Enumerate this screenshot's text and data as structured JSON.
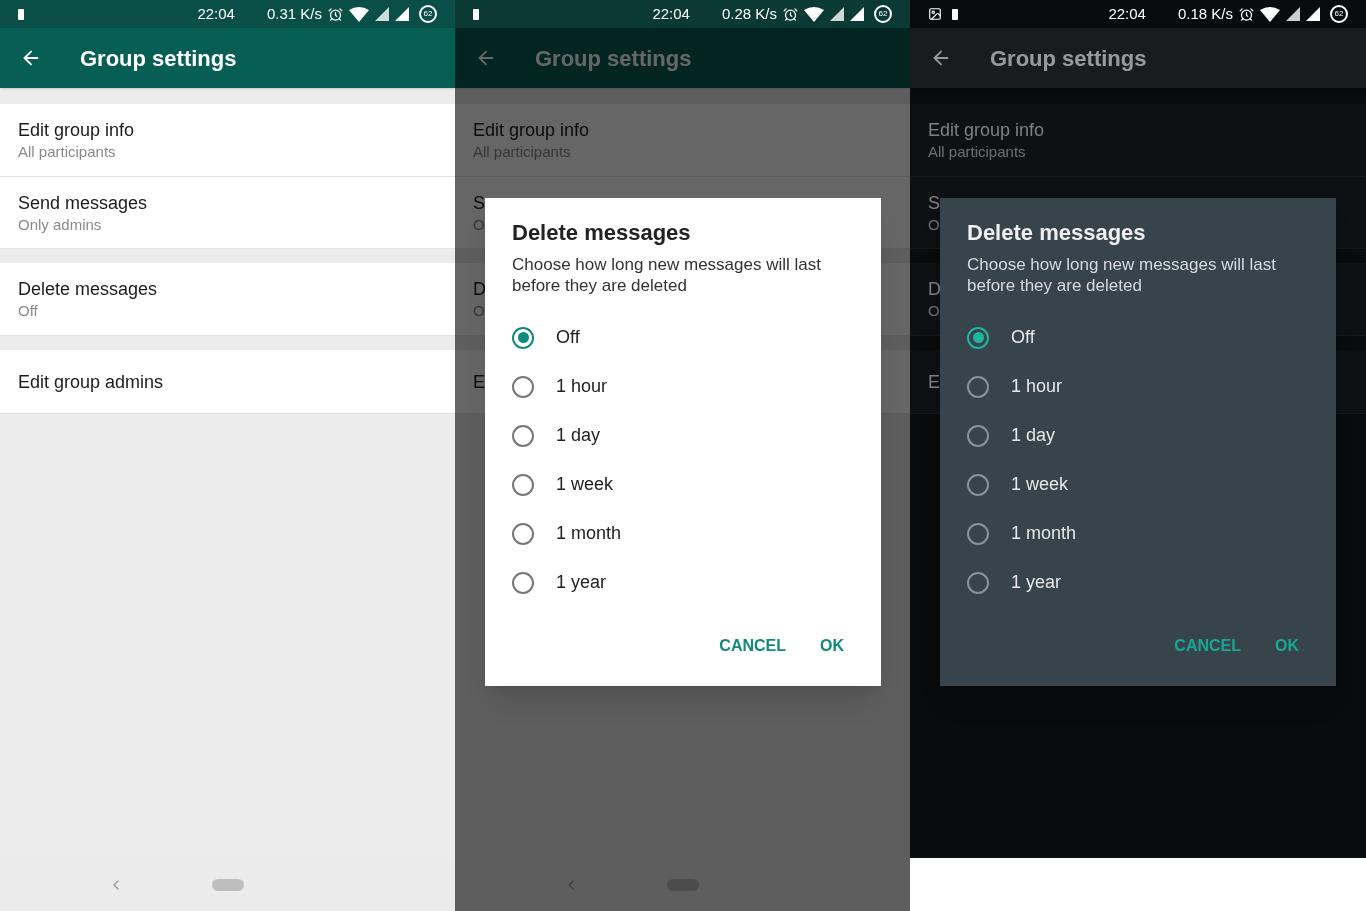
{
  "panels": [
    {
      "dark": false,
      "status_bar": {
        "left_icons": [
          {
            "kind": "battery"
          }
        ],
        "time": "22:04",
        "speed": "0.31 K/s",
        "battery": "62"
      },
      "app_bar": {
        "title": "Group settings"
      },
      "sections": [
        [
          {
            "title": "Edit group info",
            "subtitle": "All participants"
          },
          {
            "title": "Send messages",
            "subtitle": "Only admins"
          }
        ],
        [
          {
            "title": "Delete messages",
            "subtitle": "Off"
          }
        ],
        [
          {
            "title": "Edit group admins"
          }
        ]
      ],
      "nav_bar": true
    },
    {
      "dark": false,
      "status_bar": {
        "left_icons": [
          {
            "kind": "battery"
          }
        ],
        "time": "22:04",
        "speed": "0.28 K/s",
        "battery": "62"
      },
      "app_bar": {
        "title": "Group settings"
      },
      "sections": [
        [
          {
            "title": "Edit group info",
            "subtitle": "All participants"
          },
          {
            "title": "S",
            "subtitle": "O"
          }
        ],
        [
          {
            "title": "D",
            "subtitle": "O"
          }
        ],
        [
          {
            "title": "E"
          }
        ]
      ],
      "nav_bar": true,
      "dialog": {
        "title": "Delete messages",
        "description": "Choose how long new messages will last before they are deleted",
        "options": [
          {
            "label": "Off",
            "selected": true
          },
          {
            "label": "1 hour",
            "selected": false
          },
          {
            "label": "1 day",
            "selected": false
          },
          {
            "label": "1 week",
            "selected": false
          },
          {
            "label": "1 month",
            "selected": false
          },
          {
            "label": "1 year",
            "selected": false
          }
        ],
        "buttons": [
          "CANCEL",
          "OK"
        ]
      }
    },
    {
      "dark": true,
      "status_bar": {
        "left_icons": [
          {
            "kind": "image"
          },
          {
            "kind": "battery"
          }
        ],
        "time": "22:04",
        "speed": "0.18 K/s",
        "battery": "62"
      },
      "app_bar": {
        "title": "Group settings"
      },
      "sections": [
        [
          {
            "title": "Edit group info",
            "subtitle": "All participants"
          },
          {
            "title": "S",
            "subtitle": "O"
          }
        ],
        [
          {
            "title": "D",
            "subtitle": "O"
          }
        ],
        [
          {
            "title": "E"
          }
        ]
      ],
      "nav_bar": false,
      "dialog": {
        "title": "Delete messages",
        "description": "Choose how long new messages will last before they are deleted",
        "options": [
          {
            "label": "Off",
            "selected": true
          },
          {
            "label": "1 hour",
            "selected": false
          },
          {
            "label": "1 day",
            "selected": false
          },
          {
            "label": "1 week",
            "selected": false
          },
          {
            "label": "1 month",
            "selected": false
          },
          {
            "label": "1 year",
            "selected": false
          }
        ],
        "buttons": [
          "CANCEL",
          "OK"
        ]
      }
    }
  ]
}
